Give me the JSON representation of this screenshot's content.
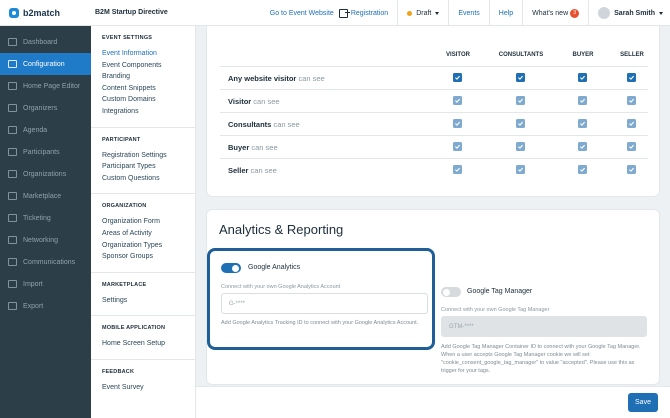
{
  "app": {
    "logo": "b2match",
    "event_title": "B2M Startup Directive"
  },
  "topbar": {
    "go_to_event": "Go to Event Website",
    "registration": "Registration",
    "status": "Draft",
    "events": "Events",
    "help": "Help",
    "whats_new": "What's new",
    "whats_new_count": "3",
    "user_name": "Sarah Smith"
  },
  "sidebar": {
    "items": [
      {
        "label": "Dashboard",
        "icon": "dashboard-icon"
      },
      {
        "label": "Configuration",
        "icon": "configuration-icon",
        "active": true
      },
      {
        "label": "Home Page Editor",
        "icon": "editor-icon"
      },
      {
        "label": "Organizers",
        "icon": "organizers-icon"
      },
      {
        "label": "Agenda",
        "icon": "agenda-icon"
      },
      {
        "label": "Participants",
        "icon": "participants-icon"
      },
      {
        "label": "Organizations",
        "icon": "organizations-icon"
      },
      {
        "label": "Marketplace",
        "icon": "marketplace-icon"
      },
      {
        "label": "Ticketing",
        "icon": "ticketing-icon"
      },
      {
        "label": "Networking",
        "icon": "networking-icon"
      },
      {
        "label": "Communications",
        "icon": "communications-icon"
      },
      {
        "label": "Import",
        "icon": "import-icon"
      },
      {
        "label": "Export",
        "icon": "export-icon"
      }
    ]
  },
  "subnav": {
    "event_settings": {
      "heading": "EVENT SETTINGS",
      "links": [
        "Event Information",
        "Event Components",
        "Branding",
        "Content Snippets",
        "Custom Domains",
        "Integrations"
      ]
    },
    "participant": {
      "heading": "PARTICIPANT",
      "links": [
        "Registration Settings",
        "Participant Types",
        "Custom Questions"
      ]
    },
    "organization": {
      "heading": "ORGANIZATION",
      "links": [
        "Organization Form",
        "Areas of Activity",
        "Organization Types",
        "Sponsor Groups"
      ]
    },
    "marketplace": {
      "heading": "MARKETPLACE",
      "links": [
        "Settings"
      ]
    },
    "mobile": {
      "heading": "MOBILE APPLICATION",
      "links": [
        "Home Screen Setup"
      ]
    },
    "feedback": {
      "heading": "FEEDBACK",
      "links": [
        "Event Survey"
      ]
    }
  },
  "permissions": {
    "columns": [
      "VISITOR",
      "CONSULTANTS",
      "BUYER",
      "SELLER"
    ],
    "can_see": "can see",
    "rows": [
      {
        "label": "Any website visitor",
        "checks": [
          true,
          true,
          true,
          true
        ]
      },
      {
        "label": "Visitor",
        "checks": [
          true,
          true,
          true,
          true
        ]
      },
      {
        "label": "Consultants",
        "checks": [
          true,
          true,
          true,
          true
        ]
      },
      {
        "label": "Buyer",
        "checks": [
          true,
          true,
          true,
          true
        ]
      },
      {
        "label": "Seller",
        "checks": [
          true,
          true,
          true,
          true
        ]
      }
    ]
  },
  "analytics": {
    "title": "Analytics & Reporting",
    "google_analytics": {
      "label": "Google Analytics",
      "enabled": true,
      "field_label": "Connect with your own Google Analytics Account",
      "placeholder": "G-****",
      "help": "Add Google Analytics Tracking ID to connect with your Google Analytics Account."
    },
    "google_tag_manager": {
      "label": "Google Tag Manager",
      "enabled": false,
      "field_label": "Connect with your own Google Tag Manager",
      "placeholder": "GTM-****",
      "help": "Add Google Tag Manager Container ID to connect with your Google Tag Manager. When a user accepts Google Tag Manager cookie we will set \"cookie_consent_google_tag_manager\" to value \"accepted\". Please use this as trigger for your tags."
    }
  },
  "actions": {
    "save": "Save"
  },
  "colors": {
    "primary": "#1f6fb5",
    "sidebar": "#2c3e48",
    "active_nav": "#1f7ac8",
    "draft_dot": "#f0a21a",
    "badge": "#e8512e"
  }
}
